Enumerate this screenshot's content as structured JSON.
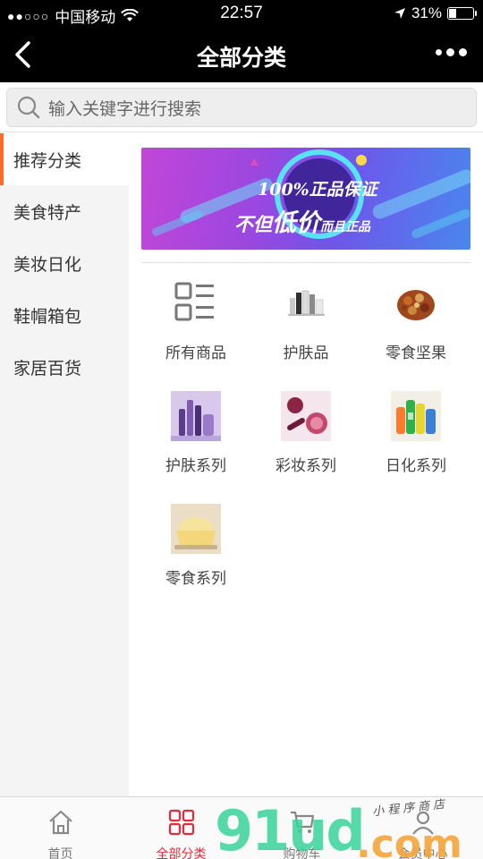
{
  "status": {
    "carrier": "中国移动",
    "time": "22:57",
    "battery": "31%",
    "battery_level": 0.31
  },
  "nav": {
    "title": "全部分类"
  },
  "search": {
    "placeholder": "输入关键字进行搜索"
  },
  "sidebar": {
    "items": [
      {
        "label": "推荐分类",
        "active": true
      },
      {
        "label": "美食特产",
        "active": false
      },
      {
        "label": "美妆日化",
        "active": false
      },
      {
        "label": "鞋帽箱包",
        "active": false
      },
      {
        "label": "家居百货",
        "active": false
      }
    ]
  },
  "banner": {
    "line1": "100%正品保证",
    "line2_a": "不但",
    "line2_b": "低价",
    "line2_c": "而且正品"
  },
  "categories": [
    {
      "label": "所有商品",
      "icon": "grid-list-icon"
    },
    {
      "label": "护肤品",
      "icon": "skincare-bottles-icon"
    },
    {
      "label": "零食坚果",
      "icon": "nuts-icon"
    },
    {
      "label": "护肤系列",
      "icon": "skincare-set-icon"
    },
    {
      "label": "彩妆系列",
      "icon": "makeup-icon"
    },
    {
      "label": "日化系列",
      "icon": "daily-chemicals-icon"
    },
    {
      "label": "零食系列",
      "icon": "snack-cake-icon"
    }
  ],
  "tabbar": {
    "tabs": [
      {
        "label": "首页",
        "active": false
      },
      {
        "label": "全部分类",
        "active": true
      },
      {
        "label": "购物车",
        "active": false
      },
      {
        "label": "会员中心",
        "active": false
      }
    ]
  },
  "watermark": {
    "main": "91ud",
    "dot": ".com",
    "sub": "小程序商店"
  },
  "colors": {
    "accent": "#e52b3b",
    "sidebar_active_bar": "#ff6b2b",
    "watermark_green": "#39d49a",
    "watermark_orange": "#f5a43a"
  }
}
